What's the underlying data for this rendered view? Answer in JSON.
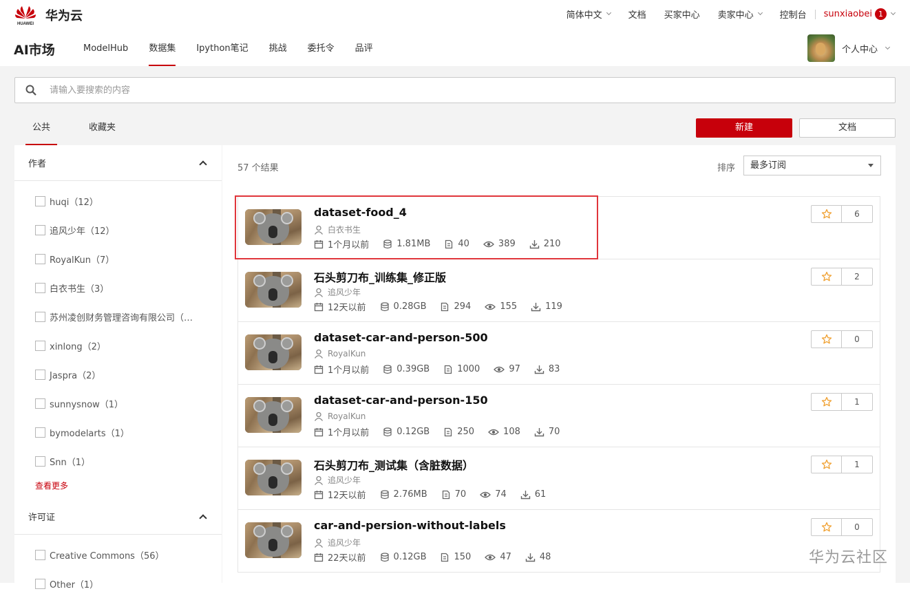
{
  "topbar": {
    "brand": "华为云",
    "logo_text": "HUAWEI",
    "links": [
      "简体中文",
      "文档",
      "买家中心",
      "卖家中心",
      "控制台"
    ],
    "user": "sunxiaobei",
    "notification_count": "1"
  },
  "navbar": {
    "title": "AI市场",
    "tabs": [
      "ModelHub",
      "数据集",
      "Ipython笔记",
      "挑战",
      "委托令",
      "品评"
    ],
    "active_tab": "数据集",
    "personal": "个人中心"
  },
  "search": {
    "placeholder": "请输入要搜索的内容"
  },
  "subtabs": [
    "公共",
    "收藏夹"
  ],
  "buttons": {
    "new": "新建",
    "doc": "文档"
  },
  "sidebar": {
    "author_title": "作者",
    "authors": [
      "huqi（12）",
      "追风少年（12）",
      "RoyalKun（7）",
      "白衣书生（3）",
      "苏州凌创财务管理咨询有限公司（…",
      "xinlong（2）",
      "Jaspra（2）",
      "sunnysnow（1）",
      "bymodelarts（1）",
      "Snn（1）"
    ],
    "more": "查看更多",
    "license_title": "许可证",
    "licenses": [
      "Creative Commons（56）",
      "Other（1）"
    ]
  },
  "results": {
    "count": "57 个结果",
    "sort_label": "排序",
    "sort_value": "最多订阅"
  },
  "datasets": [
    {
      "title": "dataset-food_4",
      "author": "白衣书生",
      "time": "1个月以前",
      "size": "1.81MB",
      "files": "40",
      "views": "389",
      "downloads": "210",
      "stars": "6"
    },
    {
      "title": "石头剪刀布_训练集_修正版",
      "author": "追风少年",
      "time": "12天以前",
      "size": "0.28GB",
      "files": "294",
      "views": "155",
      "downloads": "119",
      "stars": "2"
    },
    {
      "title": "dataset-car-and-person-500",
      "author": "RoyalKun",
      "time": "1个月以前",
      "size": "0.39GB",
      "files": "1000",
      "views": "97",
      "downloads": "83",
      "stars": "0"
    },
    {
      "title": "dataset-car-and-person-150",
      "author": "RoyalKun",
      "time": "1个月以前",
      "size": "0.12GB",
      "files": "250",
      "views": "108",
      "downloads": "70",
      "stars": "1"
    },
    {
      "title": "石头剪刀布_测试集（含脏数据）",
      "author": "追风少年",
      "time": "12天以前",
      "size": "2.76MB",
      "files": "70",
      "views": "74",
      "downloads": "61",
      "stars": "1"
    },
    {
      "title": "car-and-persion-without-labels",
      "author": "追风少年",
      "time": "22天以前",
      "size": "0.12GB",
      "files": "150",
      "views": "47",
      "downloads": "48",
      "stars": "0"
    }
  ],
  "watermark": "华为云社区",
  "colors": {
    "accent": "#c7000b",
    "highlight": "#e0353b",
    "star": "#f0a030"
  }
}
